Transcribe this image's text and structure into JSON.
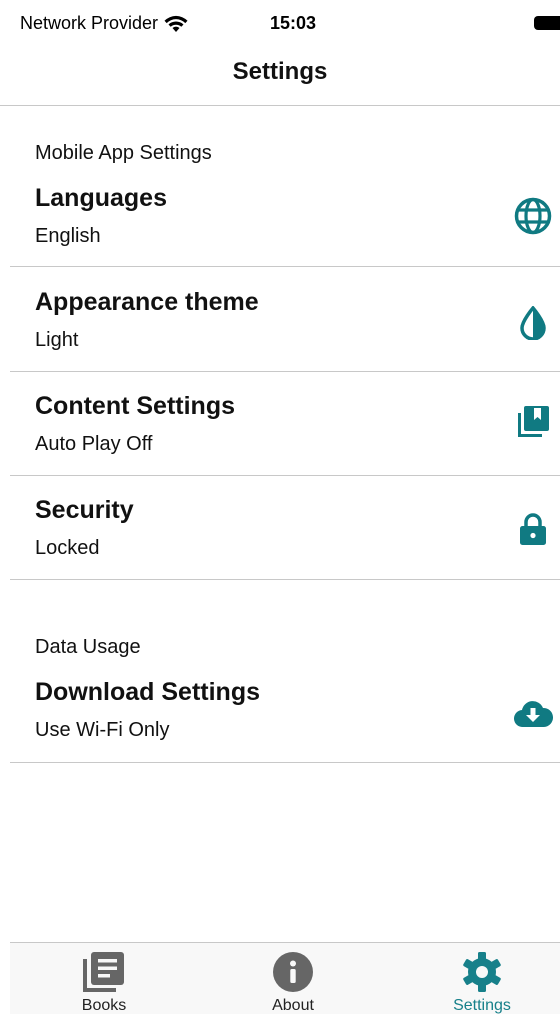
{
  "status_bar": {
    "carrier": "Network Provider",
    "time": "15:03"
  },
  "nav": {
    "title": "Settings"
  },
  "colors": {
    "accent": "#107a82",
    "tab_active": "#17808a",
    "tab_inactive": "#666666"
  },
  "sections": [
    {
      "header": "Mobile App Settings",
      "rows": [
        {
          "title": "Languages",
          "subtitle": "English",
          "icon": "globe-icon"
        },
        {
          "title": "Appearance theme",
          "subtitle": "Light",
          "icon": "drop-icon"
        },
        {
          "title": "Content Settings",
          "subtitle": "Auto Play Off",
          "icon": "library-icon"
        },
        {
          "title": "Security",
          "subtitle": "Locked",
          "icon": "lock-icon"
        }
      ]
    },
    {
      "header": "Data Usage",
      "rows": [
        {
          "title": "Download Settings",
          "subtitle": "Use Wi-Fi Only",
          "icon": "cloud-download-icon"
        }
      ]
    }
  ],
  "tabs": [
    {
      "label": "Books",
      "icon": "books-icon",
      "active": false
    },
    {
      "label": "About",
      "icon": "info-icon",
      "active": false
    },
    {
      "label": "Settings",
      "icon": "gear-icon",
      "active": true
    }
  ]
}
